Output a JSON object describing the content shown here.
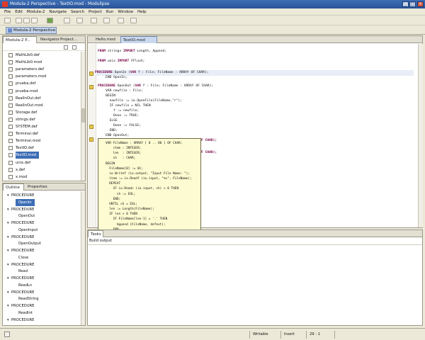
{
  "window": {
    "title": "Modula-2 Perspective - TextIO.mod - Modulipse",
    "min": "_",
    "max": "□",
    "close": "×"
  },
  "menu": [
    "File",
    "Edit",
    "Modula-2",
    "Navigate",
    "Search",
    "Project",
    "Run",
    "Window",
    "Help"
  ],
  "perspective": {
    "label": "Modula-2 Perspective"
  },
  "left_tabs": {
    "active": "Modula-2 P...",
    "t2": "Navigator",
    "t3": "Project..."
  },
  "files": [
    "MathLib0.def",
    "MathLib0.mod",
    "parameters.def",
    "parameters.mod",
    "prueba.def",
    "prueba.mod",
    "RealInOut.def",
    "RealInOut.mod",
    "Storage.def",
    "strings.def",
    "SYSTEM.def",
    "Terminal.def",
    "Terminal.mod",
    "TextIO.def",
    "TextIO.mod",
    "unix.def",
    "x.def",
    "x.mod"
  ],
  "outline_tabs": {
    "active": "Outline",
    "t2": "Properties"
  },
  "outline": [
    {
      "kind": "PROCEDURE",
      "name": "OpenIn",
      "selected": true
    },
    {
      "kind": "PROCEDURE",
      "name": "OpenOut"
    },
    {
      "kind": "PROCEDURE",
      "name": "OpenInput"
    },
    {
      "kind": "PROCEDURE",
      "name": "OpenOutput"
    },
    {
      "kind": "PROCEDURE",
      "name": "Close"
    },
    {
      "kind": "PROCEDURE",
      "name": "Read"
    },
    {
      "kind": "PROCEDURE",
      "name": "ReadLn"
    },
    {
      "kind": "PROCEDURE",
      "name": "ReadString"
    },
    {
      "kind": "PROCEDURE",
      "name": "ReadInt"
    },
    {
      "kind": "PROCEDURE",
      "name": ""
    }
  ],
  "editor_tabs": {
    "t1": "Hello.mod",
    "active": "TextIO.mod"
  },
  "code": [
    {
      "k": "FROM",
      "t": " strings ",
      "k2": "IMPORT",
      "t2": " Length, Append;"
    },
    {
      "k": "FROM",
      "t": " unix ",
      "k2": "IMPORT",
      "t2": " FFlush;"
    },
    {
      "k": "PROCEDURE",
      "t": " OpenIn (",
      "k2": "VAR",
      "t2": " f : File; FileName : ARRAY OF CHAR);"
    },
    {
      "k": "",
      "t": "    END OpenIn;",
      "k2": "",
      "t2": ""
    },
    {
      "k": "PROCEDURE",
      "t": " OpenOut (",
      "k2": "VAR",
      "t2": " f : File; FileName : ARRAY OF CHAR);"
    },
    {
      "k": "",
      "t": "    VAR newfile : File;",
      "k2": "",
      "t2": ""
    },
    {
      "k": "",
      "t": "    BEGIN",
      "k2": "",
      "t2": ""
    },
    {
      "k": "",
      "t": "      newfile := io.OpenFile(FileName,\"r\");",
      "k2": "",
      "t2": ""
    },
    {
      "k": "",
      "t": "      IF newfile = NIL THEN",
      "k2": "",
      "t2": ""
    },
    {
      "k": "",
      "t": "        f := newfile;",
      "k2": "",
      "t2": ""
    },
    {
      "k": "",
      "t": "        Done := TRUE;",
      "k2": "",
      "t2": ""
    },
    {
      "k": "",
      "t": "      ELSE",
      "k2": "",
      "t2": ""
    },
    {
      "k": "",
      "t": "        Done := FALSE;",
      "k2": "",
      "t2": ""
    },
    {
      "k": "",
      "t": "      END;",
      "k2": "",
      "t2": ""
    },
    {
      "k": "",
      "t": "    END OpenOut;",
      "k2": "",
      "t2": ""
    }
  ],
  "code_tail": [
    "F CHAR);",
    "F CHAR);"
  ],
  "popup": "VAR FileName : ARRAY [ 0 .. 80 ] OF CHAR;\n    item : INTEGER;\n    len  : INTEGER;\n    ch   : CHAR;\nBEGIN\n  FileName[0] := 0C;\n  io.Writef (io.output, \"Input File Name: \");\n  item := io.Readf (io.input, \"%s\", FileName);\n  REPEAT\n    IF io.Readc (io.input, ch) < 0 THEN\n      ch := EOL;\n    END;\n  UNTIL ch = EOL;\n  len := Length(FileName);\n  IF len > 0 THEN\n    IF FileName[len-1] = '.' THEN\n      Append (FileName, defext);\n    END;\n    OpenIn (f, FileName);\n  ELSE\n    Done := FALSE;\n  END;\nEND OpenInput;",
  "bottom": {
    "tab": "Tasks",
    "output": "Build output"
  },
  "status": {
    "s1": "Writable",
    "s2": "Insert",
    "s3": "29 : 1"
  }
}
